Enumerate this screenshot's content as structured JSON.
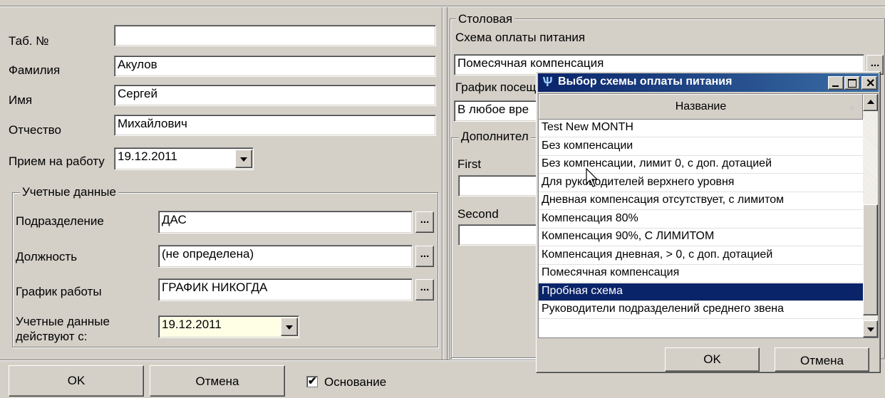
{
  "left": {
    "tab_no": {
      "label": "Таб. №",
      "value": ""
    },
    "surname": {
      "label": "Фамилия",
      "value": "Акулов"
    },
    "name": {
      "label": "Имя",
      "value": "Сергей"
    },
    "patronymic": {
      "label": "Отчество",
      "value": "Михайлович"
    },
    "hire": {
      "label": "Прием на работу",
      "value": "19.12.2011"
    },
    "accounting": {
      "legend": "Учетные данные",
      "department": {
        "label": "Подразделение",
        "value": "ДАС"
      },
      "position": {
        "label": "Должность",
        "value": "(не определена)"
      },
      "schedule": {
        "label": "График работы",
        "value": "ГРАФИК НИКОГДА"
      },
      "valid_from": {
        "label_line1": "Учетные данные",
        "label_line2": "действуют с:",
        "value": "19.12.2011"
      }
    }
  },
  "canteen": {
    "legend": "Столовая",
    "payment_scheme_label": "Схема оплаты питания",
    "payment_scheme_value": "Помесячная компенсация",
    "visit_schedule_label": "График посещ",
    "visit_schedule_value": "В любое вре",
    "additional_legend": "Дополнител",
    "first_label": "First",
    "second_label": "Second"
  },
  "bottom": {
    "ok": "OK",
    "cancel": "Отмена",
    "basis_checkbox": "Основание",
    "basis_checked": true
  },
  "dialog": {
    "title": "Выбор схемы оплаты питания",
    "column_header": "Название",
    "items": [
      "Test New MONTH",
      "Без компенсации",
      "Без компенсации, лимит 0, с доп. дотацией",
      "Для руководителей верхнего уровня",
      "Дневная компенсация отсутствует, с лимитом",
      "Компенсация 80%",
      "Компенсация 90%, С ЛИМИТОМ",
      "Компенсация дневная, > 0, с доп. дотацией",
      "Помесячная компенсация",
      "Пробная схема",
      "Руководители подразделений среднего звена"
    ],
    "selected_index": 9,
    "ok": "OK",
    "cancel": "Отмена",
    "colors": {
      "title_bar": "#0a246a",
      "selection": "#0a246a"
    }
  },
  "ellipsis": "..."
}
